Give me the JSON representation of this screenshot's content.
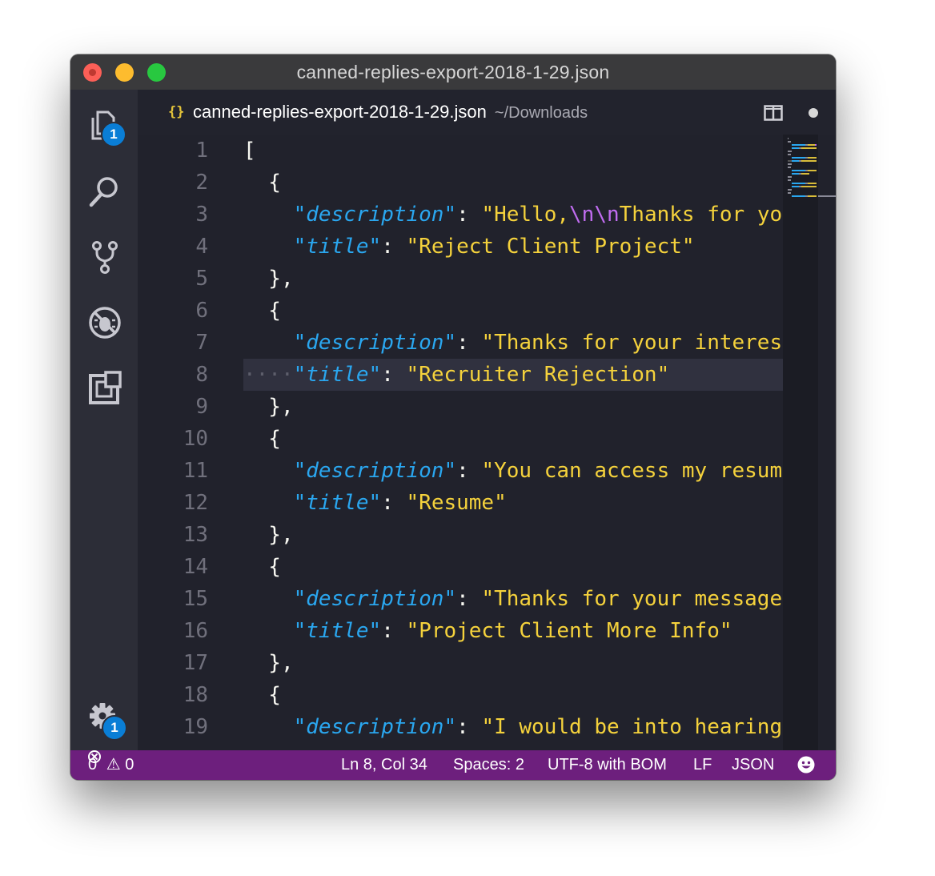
{
  "window": {
    "title": "canned-replies-export-2018-1-29.json"
  },
  "activity_bar": {
    "explorer_badge": "1",
    "settings_badge": "1",
    "items": [
      "explorer-icon",
      "search-icon",
      "source-control-icon",
      "debug-icon",
      "extensions-icon",
      "gear-icon"
    ]
  },
  "tab": {
    "icon": "{}",
    "filename": "canned-replies-export-2018-1-29.json",
    "path": "~/Downloads"
  },
  "editor": {
    "line_numbers": [
      "1",
      "2",
      "3",
      "4",
      "5",
      "6",
      "7",
      "8",
      "9",
      "10",
      "11",
      "12",
      "13",
      "14",
      "15",
      "16",
      "17",
      "18",
      "19"
    ],
    "current_line": 8,
    "lines": [
      [
        {
          "t": "[",
          "c": "p"
        }
      ],
      [
        {
          "t": "  {",
          "c": "p"
        }
      ],
      [
        {
          "t": "    ",
          "c": "p"
        },
        {
          "t": "\"description\"",
          "c": "k"
        },
        {
          "t": ": ",
          "c": "p"
        },
        {
          "t": "\"Hello,",
          "c": "s"
        },
        {
          "t": "\\n\\n",
          "c": "e"
        },
        {
          "t": "Thanks for yo",
          "c": "s"
        }
      ],
      [
        {
          "t": "    ",
          "c": "p"
        },
        {
          "t": "\"title\"",
          "c": "k"
        },
        {
          "t": ": ",
          "c": "p"
        },
        {
          "t": "\"Reject Client Project\"",
          "c": "s"
        }
      ],
      [
        {
          "t": "  },",
          "c": "p"
        }
      ],
      [
        {
          "t": "  {",
          "c": "p"
        }
      ],
      [
        {
          "t": "    ",
          "c": "p"
        },
        {
          "t": "\"description\"",
          "c": "k"
        },
        {
          "t": ": ",
          "c": "p"
        },
        {
          "t": "\"Thanks for your interes",
          "c": "s"
        }
      ],
      [
        {
          "t": "····",
          "c": "ws"
        },
        {
          "t": "\"title\"",
          "c": "k"
        },
        {
          "t": ": ",
          "c": "p"
        },
        {
          "t": "\"Recruiter Rejection\"",
          "c": "s"
        }
      ],
      [
        {
          "t": "  },",
          "c": "p"
        }
      ],
      [
        {
          "t": "  {",
          "c": "p"
        }
      ],
      [
        {
          "t": "    ",
          "c": "p"
        },
        {
          "t": "\"description\"",
          "c": "k"
        },
        {
          "t": ": ",
          "c": "p"
        },
        {
          "t": "\"You can access my resum",
          "c": "s"
        }
      ],
      [
        {
          "t": "    ",
          "c": "p"
        },
        {
          "t": "\"title\"",
          "c": "k"
        },
        {
          "t": ": ",
          "c": "p"
        },
        {
          "t": "\"Resume\"",
          "c": "s"
        }
      ],
      [
        {
          "t": "  },",
          "c": "p"
        }
      ],
      [
        {
          "t": "  {",
          "c": "p"
        }
      ],
      [
        {
          "t": "    ",
          "c": "p"
        },
        {
          "t": "\"description\"",
          "c": "k"
        },
        {
          "t": ": ",
          "c": "p"
        },
        {
          "t": "\"Thanks for your message",
          "c": "s"
        }
      ],
      [
        {
          "t": "    ",
          "c": "p"
        },
        {
          "t": "\"title\"",
          "c": "k"
        },
        {
          "t": ": ",
          "c": "p"
        },
        {
          "t": "\"Project Client More Info\"",
          "c": "s"
        }
      ],
      [
        {
          "t": "  },",
          "c": "p"
        }
      ],
      [
        {
          "t": "  {",
          "c": "p"
        }
      ],
      [
        {
          "t": "    ",
          "c": "p"
        },
        {
          "t": "\"description\"",
          "c": "k"
        },
        {
          "t": ": ",
          "c": "p"
        },
        {
          "t": "\"I would be into hearing",
          "c": "s"
        }
      ]
    ]
  },
  "status_bar": {
    "errors": "0",
    "warnings": "0",
    "cursor": "Ln 8, Col 34",
    "indent": "Spaces: 2",
    "encoding": "UTF-8 with BOM",
    "eol": "LF",
    "language": "JSON"
  },
  "colors": {
    "status_bar": "#6d1f7d",
    "keyword": "#2aa7f0",
    "string": "#f5d23c",
    "escape": "#c06cf0",
    "badge": "#0a7ed6"
  }
}
